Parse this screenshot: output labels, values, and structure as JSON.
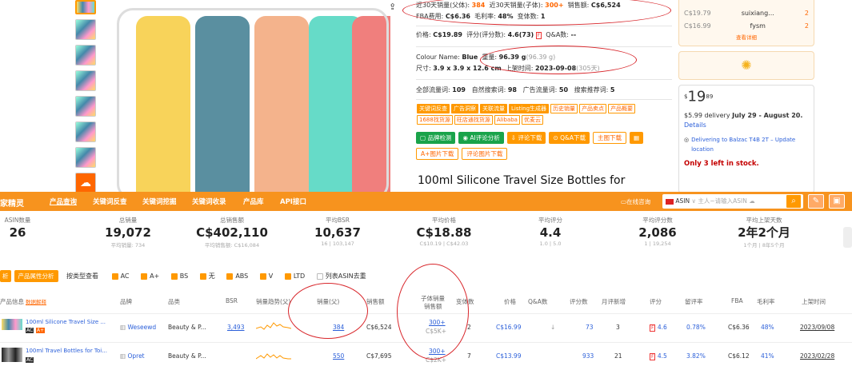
{
  "share_icon": "share-icon",
  "info": {
    "r1_sales_label": "近30天销量(父体):",
    "r1_sales": "384",
    "r1_child_label": "近30天销量(子体):",
    "r1_child": "300+",
    "r1_rev_label": "销售额:",
    "r1_rev": "C$6,524",
    "r2_fba_label": "FBA费用:",
    "r2_fba": "C$6.36",
    "r2_margin_label": "毛利率:",
    "r2_margin": "48%",
    "r2_var_label": "变体数:",
    "r2_var": "1",
    "r3_price_label": "价格:",
    "r3_price": "C$19.89",
    "r3_rating_label": "评分(评分数):",
    "r3_rating": "4.6(73)",
    "r3_qa_label": "Q&A数:",
    "r3_qa": "--",
    "r4_colour_label": "Colour Name:",
    "r4_colour": "Blue",
    "r4_weight_label": "重量:",
    "r4_weight": "96.39 g",
    "r4_weight2": "(96.39 g)",
    "r5_size_label": "尺寸:",
    "r5_size": "3.9 x 3.9 x 12.6 cm",
    "r5_date_label": "上架时间:",
    "r5_date": "2023-09-08",
    "r5_days": "(305天)",
    "r6_all_label": "全部流量词:",
    "r6_all": "109",
    "r6_nat_label": "自然搜索词:",
    "r6_nat": "98",
    "r6_ad_label": "广告流量词:",
    "r6_ad": "50",
    "r6_rec_label": "搜索推荐词:",
    "r6_rec": "5",
    "tags1": [
      "关键词反查",
      "广告洞察",
      "关联流量",
      "Listing生成器",
      "历史销量",
      "产品卖点",
      "产品概要"
    ],
    "tags2": [
      "1688找货源",
      "旺店通找货源",
      "Alibaba",
      "优麦云"
    ],
    "buttons": [
      "品牌检测",
      "AI评论分析",
      "评论下载",
      "Q&A下载",
      "主图下载"
    ],
    "buttons2": [
      "A+图片下载",
      "评论图片下载"
    ]
  },
  "title": "100ml Silicone Travel Size Bottles for",
  "right_panel": {
    "sellers": [
      {
        "price": "C$19.79",
        "name": "suixiang...",
        "count": "2"
      },
      {
        "price": "C$16.99",
        "name": "fysm",
        "count": "2"
      }
    ],
    "view_detail": "查看详细",
    "price_sup": "$",
    "price_main": "19",
    "price_cents": "89",
    "delivery_pre": "$5.99 delivery",
    "delivery_date": "July 29 - August 20.",
    "details": "Details",
    "deliver_to": "Delivering to Balzac T4B 2T – Update location",
    "stock": "Only 3 left in stock."
  },
  "nav": {
    "logo": "家精灵",
    "items": [
      "产品查询",
      "关键词反查",
      "关键词挖掘",
      "关键词收录",
      "产品库",
      "API接口"
    ],
    "online": "在线咨询",
    "market": "ASIN",
    "search_placeholder": "主人~请输入ASIN"
  },
  "stats": [
    {
      "label": "ASIN数量",
      "value": "26",
      "sub": ""
    },
    {
      "label": "总销量",
      "value": "19,072",
      "sub": "平均销量: 734"
    },
    {
      "label": "总销售额",
      "value": "C$402,110",
      "sub": "平均销售额: C$16,084"
    },
    {
      "label": "平均BSR",
      "value": "10,637",
      "sub": "16 | 103,147"
    },
    {
      "label": "平均价格",
      "value": "C$18.88",
      "sub": "C$10.19 | C$42.03"
    },
    {
      "label": "平均评分",
      "value": "4.4",
      "sub": "1.0 | 5.0"
    },
    {
      "label": "平均评分数",
      "value": "2,086",
      "sub": "1 | 19,254"
    },
    {
      "label": "平均上架天数",
      "value": "2年2个月",
      "sub": "1个月 | 8年5个月"
    }
  ],
  "filters": {
    "btn1": "析",
    "btn2": "产品属性分析",
    "view": "按类型查看",
    "checks": [
      "AC",
      "A+",
      "BS",
      "无",
      "ABS",
      "V",
      "LTD"
    ],
    "dedupe": "列表ASIN去重"
  },
  "table": {
    "headers": [
      "产品信息",
      "数据解释",
      "品牌",
      "品类",
      "BSR",
      "销量趋势(父)",
      "销量(父)",
      "销售额",
      "子体销量",
      "销售额",
      "变体数",
      "价格",
      "Q&A数",
      "评分数",
      "月评新增",
      "评分",
      "留评率",
      "FBA",
      "毛利率",
      "上架时间"
    ],
    "rows": [
      {
        "name": "100ml Silicone Travel Size ...",
        "brand": "Weseewd",
        "cat": "Beauty & P...",
        "bsr": "3,493",
        "sales": "384",
        "rev": "C$6,524",
        "child": "300+",
        "child_rev": "C$5K+",
        "var": "2",
        "price": "C$16.99",
        "qa": "",
        "reviews": "73",
        "new": "3",
        "rating": "4.6",
        "rate": "0.78%",
        "fba": "C$6.36",
        "margin": "48%",
        "date": "2023/09/08"
      },
      {
        "name": "100ml Travel Bottles for Toi...",
        "brand": "Opret",
        "cat": "Beauty & P...",
        "bsr": "",
        "sales": "550",
        "rev": "C$7,695",
        "child": "300+",
        "child_rev": "C$2K+",
        "var": "7",
        "price": "C$13.99",
        "qa": "",
        "reviews": "933",
        "new": "21",
        "rating": "4.5",
        "rate": "3.82%",
        "fba": "C$6.12",
        "margin": "41%",
        "date": "2023/02/28"
      }
    ]
  }
}
